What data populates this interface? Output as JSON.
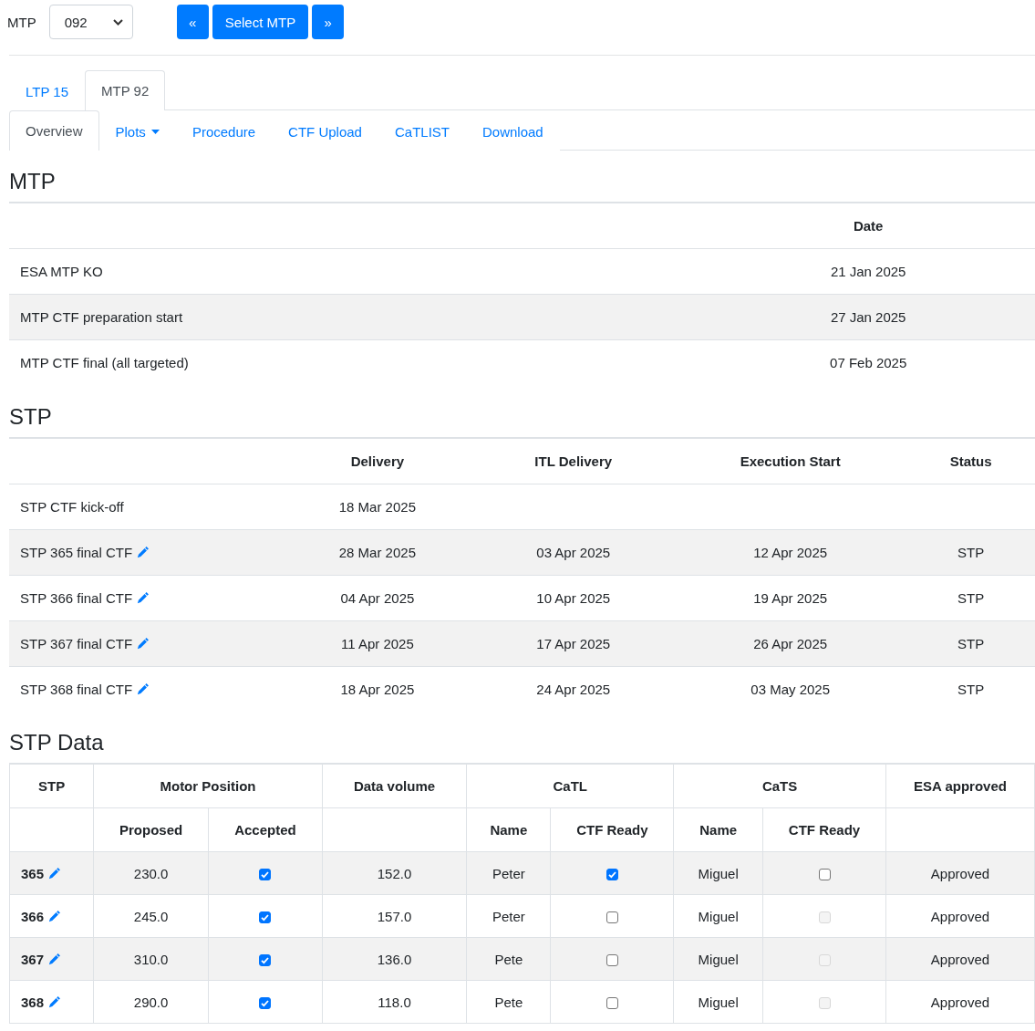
{
  "toolbar": {
    "label": "MTP",
    "select_value": "092",
    "prev_button": "«",
    "select_button": "Select MTP",
    "next_button": "»"
  },
  "tabs": [
    {
      "label": "LTP 15",
      "selected": false
    },
    {
      "label": "MTP 92",
      "selected": true
    }
  ],
  "subtabs": [
    {
      "label": "Overview",
      "selected": true,
      "kind": "link"
    },
    {
      "label": "Plots",
      "selected": false,
      "kind": "dropdown"
    },
    {
      "label": "Procedure",
      "selected": false,
      "kind": "link"
    },
    {
      "label": "CTF Upload",
      "selected": false,
      "kind": "link"
    },
    {
      "label": "CaTLIST",
      "selected": false,
      "kind": "link"
    },
    {
      "label": "Download",
      "selected": false,
      "kind": "link"
    }
  ],
  "mtp": {
    "title": "MTP",
    "columns": [
      "Date"
    ],
    "rows": [
      {
        "name": "ESA MTP KO",
        "date": "21 Jan 2025"
      },
      {
        "name": "MTP CTF preparation start",
        "date": "27 Jan 2025"
      },
      {
        "name": "MTP CTF final (all targeted)",
        "date": "07 Feb 2025"
      }
    ]
  },
  "stp": {
    "title": "STP",
    "columns": [
      "Delivery",
      "ITL Delivery",
      "Execution Start",
      "Status"
    ],
    "rows": [
      {
        "name": "STP CTF kick-off",
        "editable": false,
        "cells": [
          "18 Mar 2025",
          "",
          "",
          ""
        ]
      },
      {
        "name": "STP 365 final CTF",
        "editable": true,
        "cells": [
          "28 Mar 2025",
          "03 Apr 2025",
          "12 Apr 2025",
          "STP"
        ]
      },
      {
        "name": "STP 366 final CTF",
        "editable": true,
        "cells": [
          "04 Apr 2025",
          "10 Apr 2025",
          "19 Apr 2025",
          "STP"
        ]
      },
      {
        "name": "STP 367 final CTF",
        "editable": true,
        "cells": [
          "11 Apr 2025",
          "17 Apr 2025",
          "26 Apr 2025",
          "STP"
        ]
      },
      {
        "name": "STP 368 final CTF",
        "editable": true,
        "cells": [
          "18 Apr 2025",
          "24 Apr 2025",
          "03 May 2025",
          "STP"
        ]
      }
    ]
  },
  "stp_data": {
    "title": "STP Data",
    "columns": [
      {
        "label": "STP"
      },
      {
        "label": "Motor Position",
        "sub_headers": [
          "Proposed",
          "Accepted"
        ]
      },
      {
        "label": "Data volume"
      },
      {
        "label": "CaTL",
        "sub_headers": [
          "Name",
          "CTF Ready"
        ]
      },
      {
        "label": "CaTS",
        "sub_headers": [
          "Name",
          "CTF Ready"
        ]
      },
      {
        "label": "ESA approved"
      }
    ],
    "rows": [
      {
        "stp": "365",
        "proposed": "230.0",
        "accepted": {
          "checked": true,
          "disabled": false
        },
        "volume": "152.0",
        "catl_name": "Peter",
        "catl_ready": {
          "checked": true,
          "disabled": false
        },
        "cats_name": "Miguel",
        "cats_ready": {
          "checked": false,
          "disabled": false
        },
        "esa": "Approved"
      },
      {
        "stp": "366",
        "proposed": "245.0",
        "accepted": {
          "checked": true,
          "disabled": false
        },
        "volume": "157.0",
        "catl_name": "Peter",
        "catl_ready": {
          "checked": false,
          "disabled": false
        },
        "cats_name": "Miguel",
        "cats_ready": {
          "checked": false,
          "disabled": true
        },
        "esa": "Approved"
      },
      {
        "stp": "367",
        "proposed": "310.0",
        "accepted": {
          "checked": true,
          "disabled": false
        },
        "volume": "136.0",
        "catl_name": "Pete",
        "catl_ready": {
          "checked": false,
          "disabled": false
        },
        "cats_name": "Miguel",
        "cats_ready": {
          "checked": false,
          "disabled": true
        },
        "esa": "Approved"
      },
      {
        "stp": "368",
        "proposed": "290.0",
        "accepted": {
          "checked": true,
          "disabled": false
        },
        "volume": "118.0",
        "catl_name": "Pete",
        "catl_ready": {
          "checked": false,
          "disabled": false
        },
        "cats_name": "Miguel",
        "cats_ready": {
          "checked": false,
          "disabled": true
        },
        "esa": "Approved"
      }
    ]
  }
}
